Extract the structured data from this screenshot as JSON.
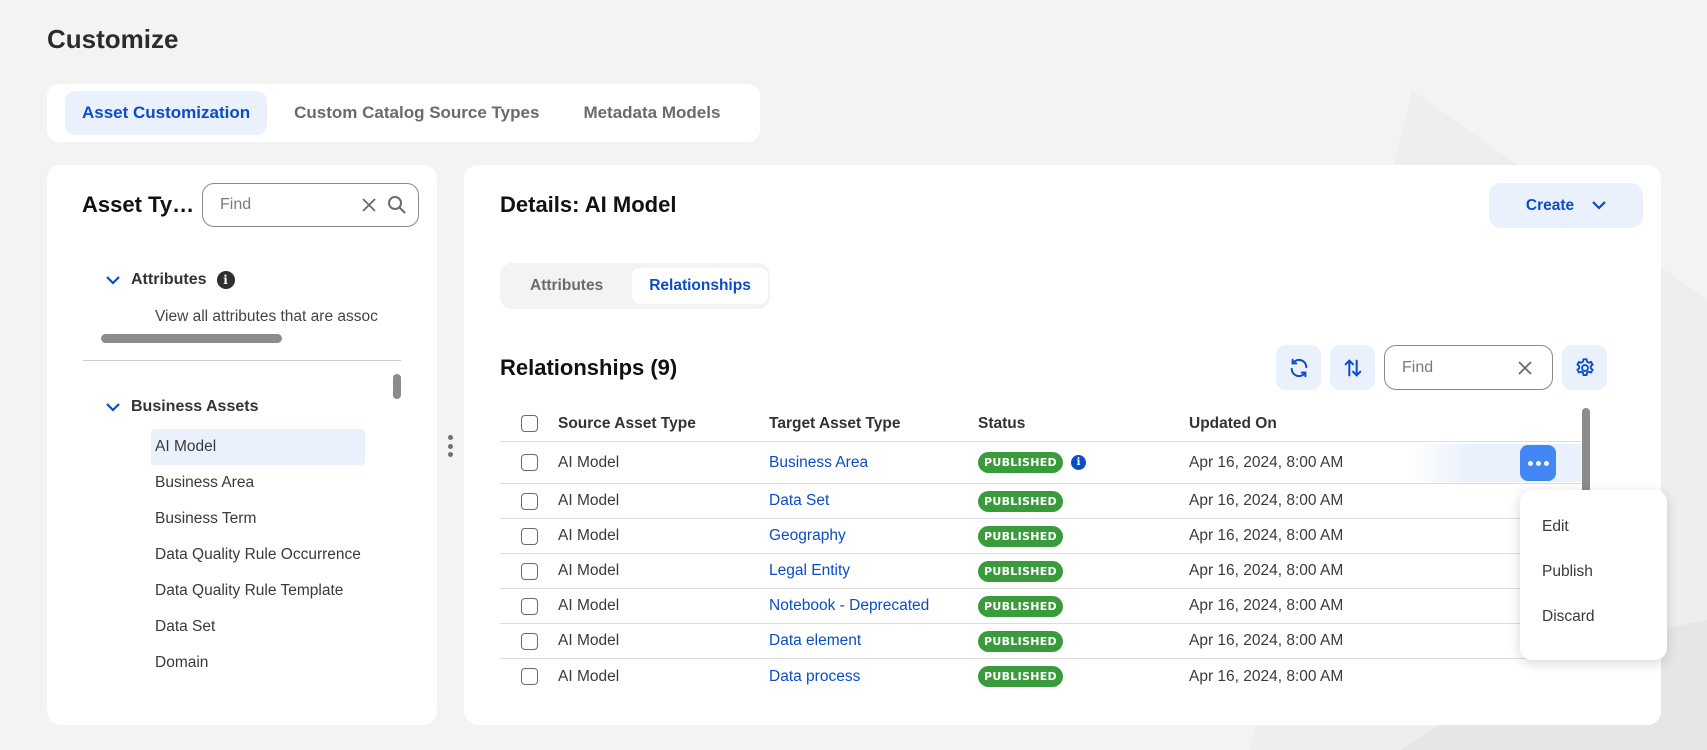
{
  "page": {
    "title": "Customize"
  },
  "top_tabs": [
    {
      "label": "Asset Customization",
      "active": true
    },
    {
      "label": "Custom Catalog Source Types",
      "active": false
    },
    {
      "label": "Metadata Models",
      "active": false
    }
  ],
  "left_panel": {
    "title": "Asset Types",
    "search": {
      "placeholder": "Find",
      "value": ""
    },
    "attributes_section": {
      "label": "Attributes",
      "description": "View all attributes that are assoc"
    },
    "business_assets_section": {
      "label": "Business Assets",
      "items": [
        {
          "label": "AI Model",
          "selected": true
        },
        {
          "label": "Business Area",
          "selected": false
        },
        {
          "label": "Business Term",
          "selected": false
        },
        {
          "label": "Data Quality Rule Occurrence",
          "selected": false
        },
        {
          "label": "Data Quality Rule Template",
          "selected": false
        },
        {
          "label": "Data Set",
          "selected": false
        },
        {
          "label": "Domain",
          "selected": false
        }
      ]
    }
  },
  "details": {
    "title": "Details: AI Model",
    "create_label": "Create",
    "sub_tabs": [
      {
        "label": "Attributes",
        "active": false
      },
      {
        "label": "Relationships",
        "active": true
      }
    ],
    "relationships_title": "Relationships (9)",
    "find": {
      "placeholder": "Find",
      "value": ""
    },
    "table": {
      "columns": [
        "Source Asset Type",
        "Target Asset Type",
        "Status",
        "Updated On"
      ],
      "rows": [
        {
          "source": "AI Model",
          "target": "Business Area",
          "status": "PUBLISHED",
          "updated": "Apr 16, 2024, 8:00 AM",
          "info": true
        },
        {
          "source": "AI Model",
          "target": "Data Set",
          "status": "PUBLISHED",
          "updated": "Apr 16, 2024, 8:00 AM"
        },
        {
          "source": "AI Model",
          "target": "Geography",
          "status": "PUBLISHED",
          "updated": "Apr 16, 2024, 8:00 AM"
        },
        {
          "source": "AI Model",
          "target": "Legal Entity",
          "status": "PUBLISHED",
          "updated": "Apr 16, 2024, 8:00 AM"
        },
        {
          "source": "AI Model",
          "target": "Notebook - Deprecated",
          "status": "PUBLISHED",
          "updated": "Apr 16, 2024, 8:00 AM"
        },
        {
          "source": "AI Model",
          "target": "Data element",
          "status": "PUBLISHED",
          "updated": "Apr 16, 2024, 8:00 AM"
        },
        {
          "source": "AI Model",
          "target": "Data process",
          "status": "PUBLISHED",
          "updated": "Apr 16, 2024, 8:00 AM"
        }
      ]
    },
    "row_menu": [
      "Edit",
      "Publish",
      "Discard"
    ]
  },
  "colors": {
    "accent": "#0b4cc7",
    "accent_light": "#eaf1fd",
    "published": "#3a9b3c",
    "more_button": "#4287f5",
    "background": "#f3f3f3"
  }
}
